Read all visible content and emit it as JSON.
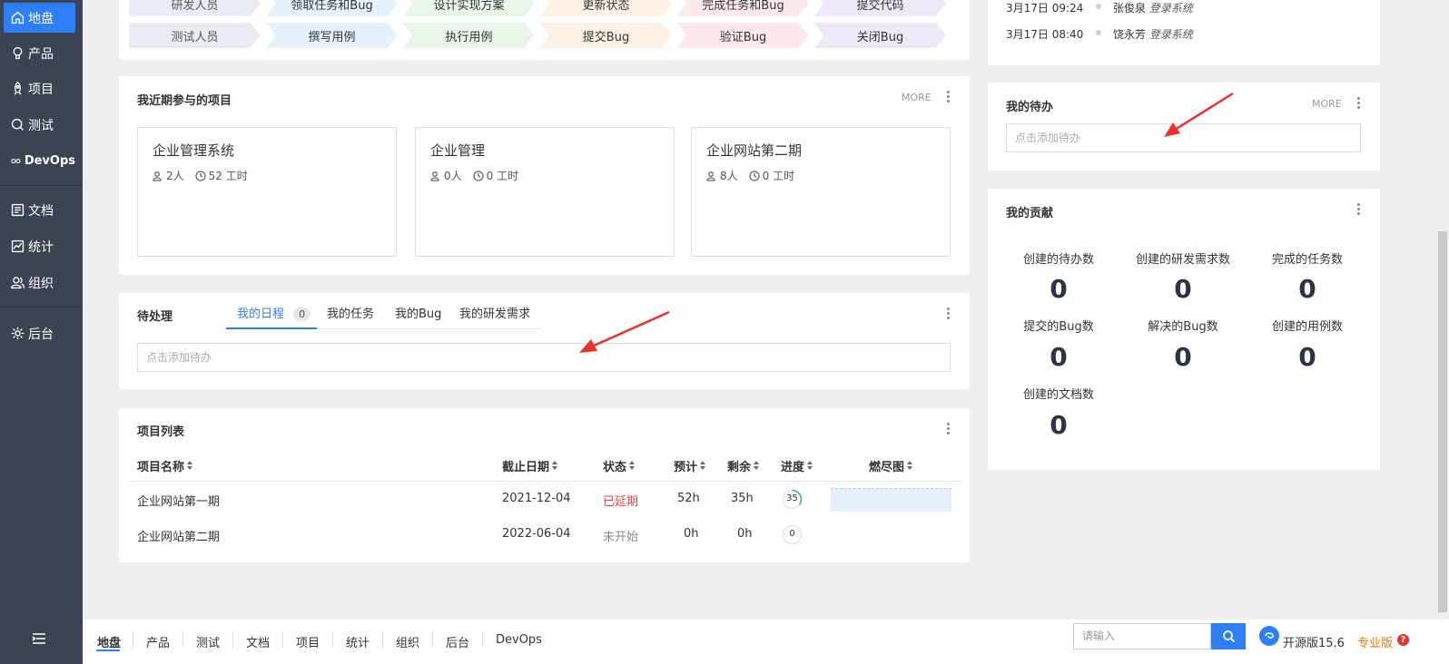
{
  "sidebar": {
    "items": [
      {
        "label": "地盘",
        "icon": "home-icon",
        "active": true
      },
      {
        "label": "产品",
        "icon": "lightbulb-icon"
      },
      {
        "label": "项目",
        "icon": "rocket-icon"
      },
      {
        "label": "测试",
        "icon": "search-icon"
      },
      {
        "label": "DevOps",
        "icon": "infinity-icon"
      },
      {
        "label": "文档",
        "icon": "document-icon"
      },
      {
        "label": "统计",
        "icon": "chart-icon"
      },
      {
        "label": "组织",
        "icon": "users-icon"
      },
      {
        "label": "后台",
        "icon": "gear-icon"
      }
    ],
    "collapse_icon": "menu-collapse-icon"
  },
  "flow": {
    "row1": {
      "label": "研发人员",
      "steps": [
        "领取任务和Bug",
        "设计实现方案",
        "更新状态",
        "完成任务和Bug",
        "提交代码"
      ]
    },
    "row2": {
      "label": "测试人员",
      "steps": [
        "撰写用例",
        "执行用例",
        "提交Bug",
        "验证Bug",
        "关闭Bug"
      ]
    },
    "step_colors": [
      "#e5f1fd",
      "#e9f5e9",
      "#fdf1e4",
      "#fde9ec",
      "#efe8f6"
    ]
  },
  "recent_projects": {
    "title": "我近期参与的项目",
    "more": "MORE",
    "items": [
      {
        "name": "企业管理系统",
        "members": "2人",
        "hours": "52 工时"
      },
      {
        "name": "企业管理",
        "members": "0人",
        "hours": "0 工时"
      },
      {
        "name": "企业网站第二期",
        "members": "8人",
        "hours": "0 工时"
      }
    ]
  },
  "pending": {
    "title": "待处理",
    "tabs": [
      {
        "label": "我的日程",
        "badge": "0",
        "active": true
      },
      {
        "label": "我的任务"
      },
      {
        "label": "我的Bug"
      },
      {
        "label": "我的研发需求"
      }
    ],
    "input_placeholder": "点击添加待办"
  },
  "project_list": {
    "title": "项目列表",
    "columns": [
      "项目名称",
      "截止日期",
      "状态",
      "预计",
      "剩余",
      "进度",
      "燃尽图"
    ],
    "rows": [
      {
        "name": "企业网站第一期",
        "deadline": "2021-12-04",
        "status": "已延期",
        "estimate": "52h",
        "left": "35h",
        "progress": "35",
        "status_color": "#e54545"
      },
      {
        "name": "企业网站第二期",
        "deadline": "2022-06-04",
        "status": "未开始",
        "estimate": "0h",
        "left": "0h",
        "progress": "0",
        "status_color": "#888888"
      }
    ]
  },
  "dynamics": {
    "items": [
      {
        "time": "3月17日 09:24",
        "user": "张俊泉",
        "action": "登录系统"
      },
      {
        "time": "3月17日 08:40",
        "user": "饶永芳",
        "action": "登录系统"
      }
    ]
  },
  "my_todo": {
    "title": "我的待办",
    "more": "MORE",
    "input_placeholder": "点击添加待办"
  },
  "contribution": {
    "title": "我的贡献",
    "items": [
      {
        "label": "创建的待办数",
        "value": "0"
      },
      {
        "label": "创建的研发需求数",
        "value": "0"
      },
      {
        "label": "完成的任务数",
        "value": "0"
      },
      {
        "label": "提交的Bug数",
        "value": "0"
      },
      {
        "label": "解决的Bug数",
        "value": "0"
      },
      {
        "label": "创建的用例数",
        "value": "0"
      },
      {
        "label": "创建的文档数",
        "value": "0"
      }
    ]
  },
  "bottom_nav": {
    "items": [
      "地盘",
      "产品",
      "测试",
      "文档",
      "项目",
      "统计",
      "组织",
      "后台",
      "DevOps"
    ],
    "search_placeholder": "请输入",
    "version": "开源版15.6",
    "pro": "专业版"
  },
  "colors": {
    "accent": "#2e7ff5",
    "sidebar": "#3c4353",
    "arrow": "#e8312a"
  }
}
